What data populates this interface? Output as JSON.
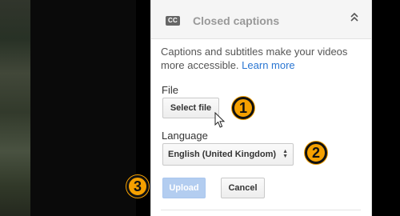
{
  "panel": {
    "icon_text": "CC",
    "title": "Closed captions",
    "description": "Captions and subtitles make your videos more accessible.",
    "learn_more": "Learn more",
    "file_label": "File",
    "select_file_button": "Select file",
    "language_label": "Language",
    "language_value": "English (United Kingdom)",
    "upload_button": "Upload",
    "cancel_button": "Cancel"
  },
  "annotations": [
    "1",
    "2",
    "3"
  ],
  "colors": {
    "badge": "#f5a000",
    "link": "#2a76d2",
    "upload_disabled": "#b3cdf0"
  },
  "icons": [
    "cc-icon",
    "collapse-icon",
    "select-arrows-icon",
    "mouse-cursor-icon"
  ]
}
